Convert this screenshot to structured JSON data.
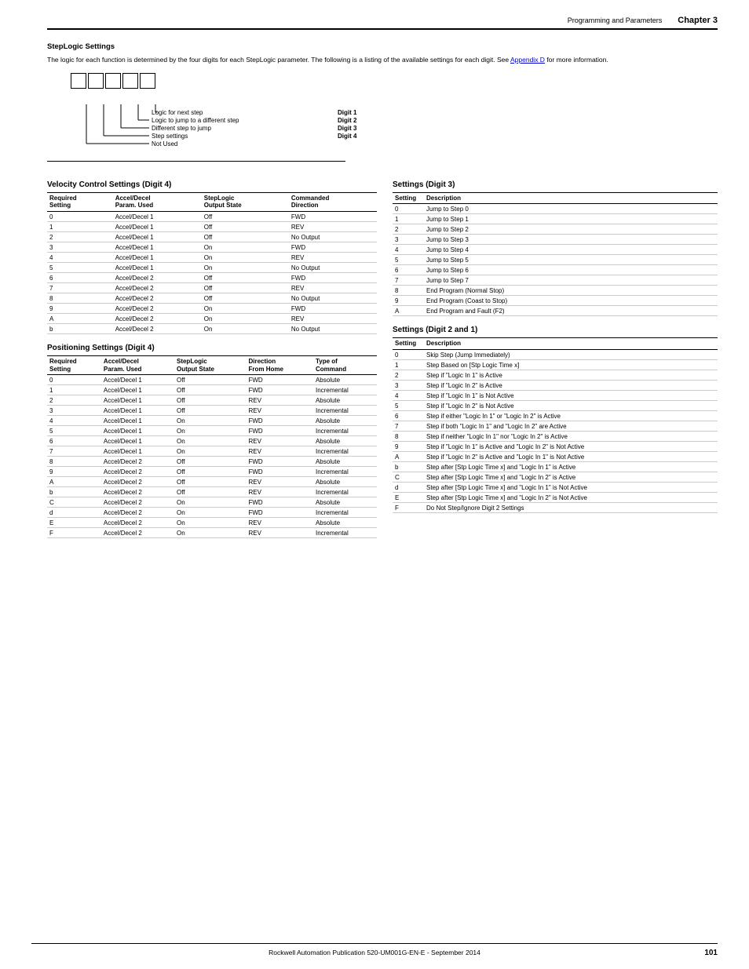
{
  "header": {
    "title": "Programming and Parameters",
    "chapter": "Chapter 3"
  },
  "section": {
    "title": "StepLogic Settings",
    "intro": "The logic for each function is determined by the four digits for each StepLogic parameter. The following is a listing of the available settings for each digit. See ",
    "link_text": "Appendix D",
    "intro_end": " for more information."
  },
  "digit_labels": [
    {
      "text": "Logic for next step",
      "digit": "Digit 1"
    },
    {
      "text": "Logic to jump to a different step",
      "digit": "Digit 2"
    },
    {
      "text": "Different step to jump",
      "digit": "Digit 3"
    },
    {
      "text": "Step settings",
      "digit": "Digit 4"
    },
    {
      "text": "Not Used",
      "digit": ""
    }
  ],
  "velocity_table": {
    "title": "Velocity Control Settings (Digit 4)",
    "headers": [
      "Required\nSetting",
      "Accel/Decel\nParam. Used",
      "StepLogic\nOutput State",
      "Commanded\nDirection"
    ],
    "rows": [
      [
        "0",
        "Accel/Decel 1",
        "Off",
        "FWD"
      ],
      [
        "1",
        "Accel/Decel 1",
        "Off",
        "REV"
      ],
      [
        "2",
        "Accel/Decel 1",
        "Off",
        "No Output"
      ],
      [
        "3",
        "Accel/Decel 1",
        "On",
        "FWD"
      ],
      [
        "4",
        "Accel/Decel 1",
        "On",
        "REV"
      ],
      [
        "5",
        "Accel/Decel 1",
        "On",
        "No Output"
      ],
      [
        "6",
        "Accel/Decel 2",
        "Off",
        "FWD"
      ],
      [
        "7",
        "Accel/Decel 2",
        "Off",
        "REV"
      ],
      [
        "8",
        "Accel/Decel 2",
        "Off",
        "No Output"
      ],
      [
        "9",
        "Accel/Decel 2",
        "On",
        "FWD"
      ],
      [
        "A",
        "Accel/Decel 2",
        "On",
        "REV"
      ],
      [
        "b",
        "Accel/Decel 2",
        "On",
        "No Output"
      ]
    ]
  },
  "positioning_table": {
    "title": "Positioning Settings (Digit 4)",
    "headers": [
      "Required\nSetting",
      "Accel/Decel\nParam. Used",
      "StepLogic\nOutput State",
      "Direction\nFrom Home",
      "Type of\nCommand"
    ],
    "rows": [
      [
        "0",
        "Accel/Decel 1",
        "Off",
        "FWD",
        "Absolute"
      ],
      [
        "1",
        "Accel/Decel 1",
        "Off",
        "FWD",
        "Incremental"
      ],
      [
        "2",
        "Accel/Decel 1",
        "Off",
        "REV",
        "Absolute"
      ],
      [
        "3",
        "Accel/Decel 1",
        "Off",
        "REV",
        "Incremental"
      ],
      [
        "4",
        "Accel/Decel 1",
        "On",
        "FWD",
        "Absolute"
      ],
      [
        "5",
        "Accel/Decel 1",
        "On",
        "FWD",
        "Incremental"
      ],
      [
        "6",
        "Accel/Decel 1",
        "On",
        "REV",
        "Absolute"
      ],
      [
        "7",
        "Accel/Decel 1",
        "On",
        "REV",
        "Incremental"
      ],
      [
        "8",
        "Accel/Decel 2",
        "Off",
        "FWD",
        "Absolute"
      ],
      [
        "9",
        "Accel/Decel 2",
        "Off",
        "FWD",
        "Incremental"
      ],
      [
        "A",
        "Accel/Decel 2",
        "Off",
        "REV",
        "Absolute"
      ],
      [
        "b",
        "Accel/Decel 2",
        "Off",
        "REV",
        "Incremental"
      ],
      [
        "C",
        "Accel/Decel 2",
        "On",
        "FWD",
        "Absolute"
      ],
      [
        "d",
        "Accel/Decel 2",
        "On",
        "FWD",
        "Incremental"
      ],
      [
        "E",
        "Accel/Decel 2",
        "On",
        "REV",
        "Absolute"
      ],
      [
        "F",
        "Accel/Decel 2",
        "On",
        "REV",
        "Incremental"
      ]
    ]
  },
  "digit3_table": {
    "title": "Settings (Digit 3)",
    "headers": [
      "Setting",
      "Description"
    ],
    "rows": [
      [
        "0",
        "Jump to Step 0"
      ],
      [
        "1",
        "Jump to Step 1"
      ],
      [
        "2",
        "Jump to Step 2"
      ],
      [
        "3",
        "Jump to Step 3"
      ],
      [
        "4",
        "Jump to Step 4"
      ],
      [
        "5",
        "Jump to Step 5"
      ],
      [
        "6",
        "Jump to Step 6"
      ],
      [
        "7",
        "Jump to Step 7"
      ],
      [
        "8",
        "End Program (Normal Stop)"
      ],
      [
        "9",
        "End Program (Coast to Stop)"
      ],
      [
        "A",
        "End Program and Fault (F2)"
      ]
    ]
  },
  "digit2and1_table": {
    "title": "Settings (Digit 2 and 1)",
    "headers": [
      "Setting",
      "Description"
    ],
    "rows": [
      [
        "0",
        "Skip Step (Jump Immediately)"
      ],
      [
        "1",
        "Step Based on [Stp Logic Time x]"
      ],
      [
        "2",
        "Step if \"Logic In 1\" is Active"
      ],
      [
        "3",
        "Step if \"Logic In 2\" is Active"
      ],
      [
        "4",
        "Step if \"Logic In 1\" is Not Active"
      ],
      [
        "5",
        "Step if \"Logic In 2\" is Not Active"
      ],
      [
        "6",
        "Step if either \"Logic In 1\" or \"Logic In 2\" is Active"
      ],
      [
        "7",
        "Step if both \"Logic In 1\" and \"Logic In 2\" are Active"
      ],
      [
        "8",
        "Step if neither \"Logic In 1\" nor \"Logic In 2\" is Active"
      ],
      [
        "9",
        "Step if \"Logic In 1\" is Active and \"Logic In 2\" is Not Active"
      ],
      [
        "A",
        "Step if \"Logic In 2\" is Active and \"Logic In 1\" is Not Active"
      ],
      [
        "b",
        "Step after [Stp Logic Time x] and \"Logic In 1\" is Active"
      ],
      [
        "C",
        "Step after [Stp Logic Time x] and \"Logic In 2\" is Active"
      ],
      [
        "d",
        "Step after [Stp Logic Time x] and \"Logic In 1\" is Not Active"
      ],
      [
        "E",
        "Step after [Stp Logic Time x] and \"Logic In 2\" is Not Active"
      ],
      [
        "F",
        "Do Not Step/Ignore Digit 2 Settings"
      ]
    ]
  },
  "footer": {
    "text": "Rockwell Automation Publication 520-UM001G-EN-E - September 2014",
    "page": "101"
  }
}
